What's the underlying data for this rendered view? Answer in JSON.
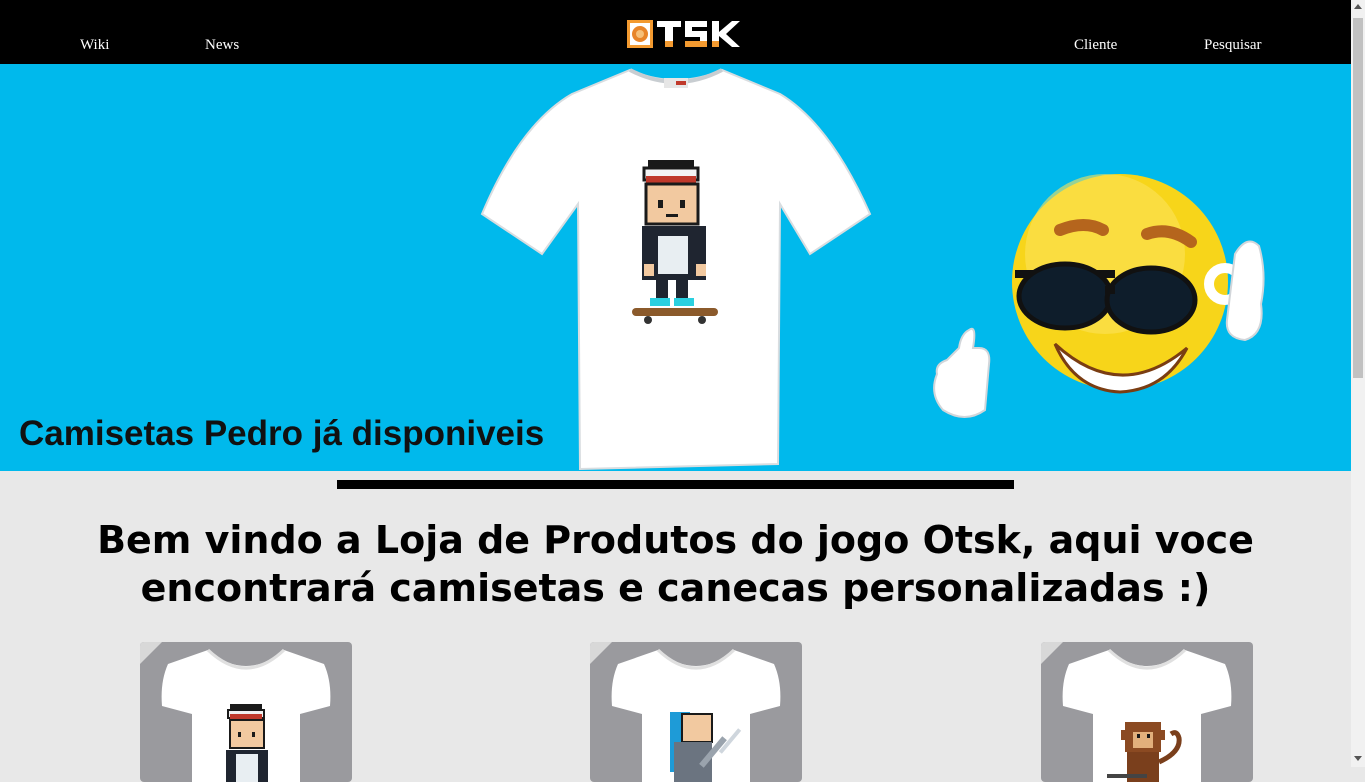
{
  "nav": {
    "wiki_label": "Wiki",
    "news_label": "News",
    "cliente_label": "Cliente",
    "pesquisar_label": "Pesquisar",
    "logo_text": "OTSK"
  },
  "hero": {
    "caption": "Camisetas Pedro já disponiveis",
    "background_color": "#00b9ec"
  },
  "welcome": {
    "line1": "Bem vindo a Loja de Produtos do jogo Otsk, aqui voce",
    "line2": "encontrará camisetas e canecas personalizadas :)"
  },
  "products": [
    {
      "design": "pedro-skater"
    },
    {
      "design": "blue-hair-swordsman"
    },
    {
      "design": "monkey"
    }
  ]
}
